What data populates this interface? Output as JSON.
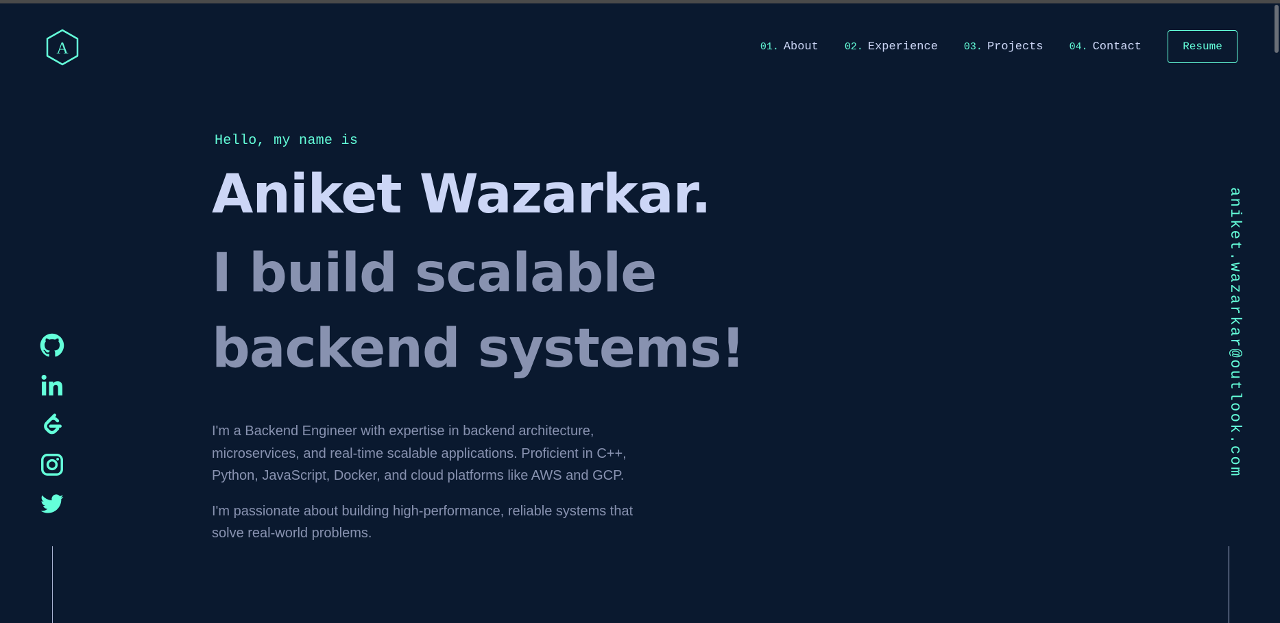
{
  "colors": {
    "background": "#0a192f",
    "accent": "#64ffda",
    "heading": "#ccd6f6",
    "text": "#8892b0"
  },
  "logo": {
    "letter": "A",
    "icon": "hexagon-logo-icon"
  },
  "nav": {
    "items": [
      {
        "number": "01.",
        "label": "About"
      },
      {
        "number": "02.",
        "label": "Experience"
      },
      {
        "number": "03.",
        "label": "Projects"
      },
      {
        "number": "04.",
        "label": "Contact"
      }
    ],
    "resume_label": "Resume"
  },
  "hero": {
    "greeting": "Hello, my name is",
    "name": "Aniket Wazarkar.",
    "tagline": "I build scalable backend systems!",
    "bio": [
      "I'm a Backend Engineer with expertise in backend architecture, microservices, and real-time scalable applications. Proficient in C++, Python, JavaScript, Docker, and cloud platforms like AWS and GCP.",
      "I'm passionate about building high-performance, reliable systems that solve real-world problems."
    ]
  },
  "social": {
    "icons": [
      "github-icon",
      "linkedin-icon",
      "leetcode-icon",
      "instagram-icon",
      "twitter-icon"
    ]
  },
  "email": "aniket.wazarkar@outlook.com"
}
